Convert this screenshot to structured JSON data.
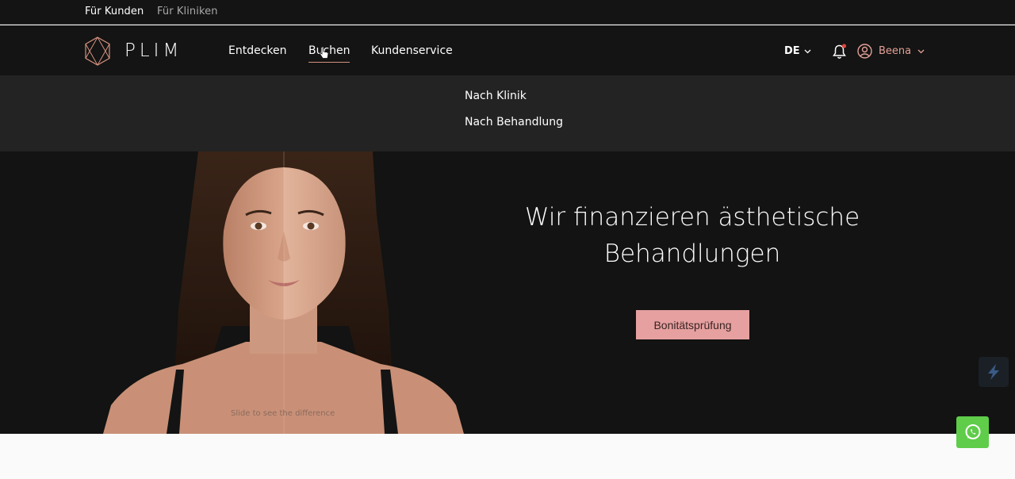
{
  "topbar": {
    "links": [
      "Für Kunden",
      "Für Kliniken"
    ]
  },
  "header": {
    "brand": "PLIM",
    "nav": [
      "Entdecken",
      "Buchen",
      "Kundenservice"
    ],
    "language": "DE",
    "user_name": "Beena"
  },
  "dropdown": {
    "items": [
      "Nach Klinik",
      "Nach Behandlung"
    ]
  },
  "hero": {
    "headline_line1": "Wir finanzieren ästhetische",
    "headline_line2": "Behandlungen",
    "cta_label": "Bonitätsprüfung",
    "slider_hint": "Slide to see the difference"
  },
  "colors": {
    "accent": "#e5a09f",
    "header_bg": "#131413",
    "dropdown_bg": "#232323",
    "whatsapp": "#5fcc4a"
  },
  "icons": [
    "plim-logo-icon",
    "cursor-icon",
    "chevron-down-icon",
    "bell-icon",
    "user-circle-icon",
    "whatsapp-icon",
    "widget-icon"
  ]
}
